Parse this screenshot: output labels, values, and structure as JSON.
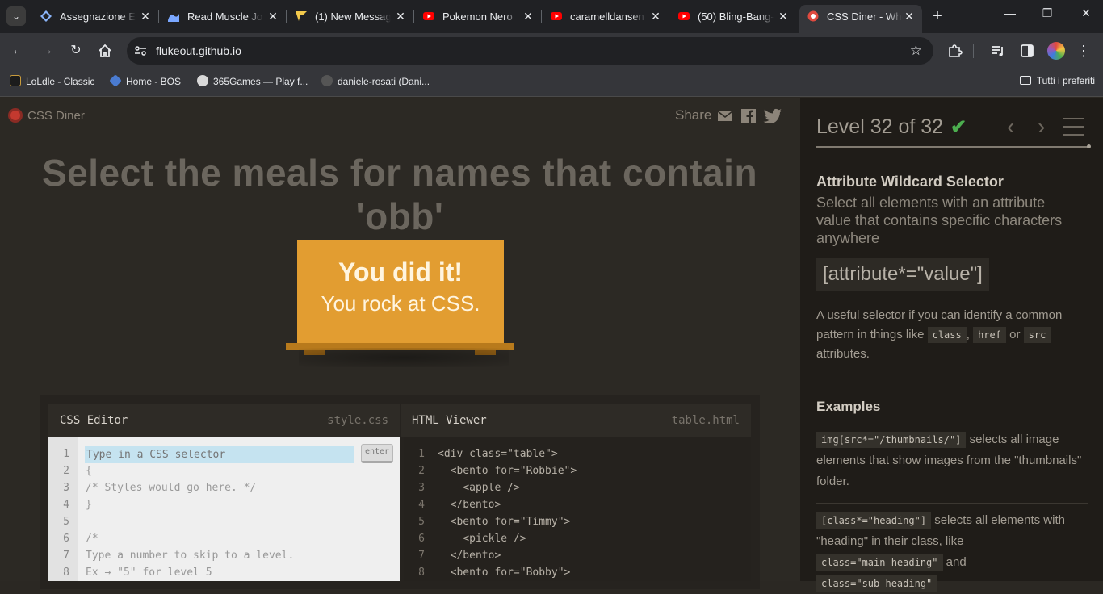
{
  "browser": {
    "tabs": [
      {
        "title": "Assegnazione Es",
        "icon": "diamond-icon",
        "color": "#8ab4f8"
      },
      {
        "title": "Read Muscle Jos",
        "icon": "wave-icon",
        "color": "#7aa7ff"
      },
      {
        "title": "(1) New Messag",
        "icon": "valorant-icon",
        "color": "#f2c94c"
      },
      {
        "title": "Pokemon Nero",
        "icon": "youtube-icon",
        "color": "#ff0000"
      },
      {
        "title": "caramelldansen",
        "icon": "youtube-icon",
        "color": "#ff0000"
      },
      {
        "title": "(50) Bling-Bang-",
        "icon": "youtube-icon",
        "color": "#ff0000"
      },
      {
        "title": "CSS Diner - Whe",
        "icon": "css-diner-icon",
        "color": "#e04a3f"
      }
    ],
    "url": "flukeout.github.io",
    "bookmarks": [
      {
        "label": "LoLdle - Classic"
      },
      {
        "label": "Home - BOS"
      },
      {
        "label": "365Games — Play f..."
      },
      {
        "label": "daniele-rosati (Dani..."
      }
    ],
    "all_bookmarks": "Tutti i preferiti"
  },
  "game": {
    "logo": "CSS Diner",
    "share": "Share",
    "order": "Select the meals for names that contain 'obb'",
    "win_title": "You did it!",
    "win_sub": "You rock at CSS.",
    "css_editor": {
      "title": "CSS Editor",
      "file": "style.css",
      "placeholder": "Type in a CSS selector",
      "enter": "enter",
      "lines": [
        "{",
        "/* Styles would go here. */",
        "}",
        "",
        "/*",
        "Type a number to skip to a level.",
        "Ex → \"5\" for level 5"
      ]
    },
    "html_viewer": {
      "title": "HTML Viewer",
      "file": "table.html",
      "lines": [
        "<div class=\"table\">",
        "  <bento for=\"Robbie\">",
        "    <apple />",
        "  </bento>",
        "  <bento for=\"Timmy\">",
        "    <pickle />",
        "  </bento>",
        "  <bento for=\"Bobby\">"
      ]
    }
  },
  "sidebar": {
    "level": "Level 32 of 32",
    "check_color": "#4cae4f",
    "selector_name": "Attribute Wildcard Selector",
    "description": "Select all elements with an attribute value that contains specific characters anywhere",
    "syntax": "[attribute*=\"value\"]",
    "hint_pre": "A useful selector if you can identify a common pattern in things like",
    "hint_code1": "class",
    "hint_code2": "href",
    "hint_or": "or",
    "hint_code3": "src",
    "hint_post": "attributes.",
    "examples_title": "Examples",
    "example1_code": "img[src*=\"/thumbnails/\"]",
    "example1_text": "selects all image elements that show images from the \"thumbnails\" folder.",
    "example2_code": "[class*=\"heading\"]",
    "example2_text_a": "selects all elements with \"heading\" in their class, like",
    "example2_code2": "class=\"main-heading\"",
    "example2_and": "and",
    "example2_code3": "class=\"sub-heading\""
  }
}
